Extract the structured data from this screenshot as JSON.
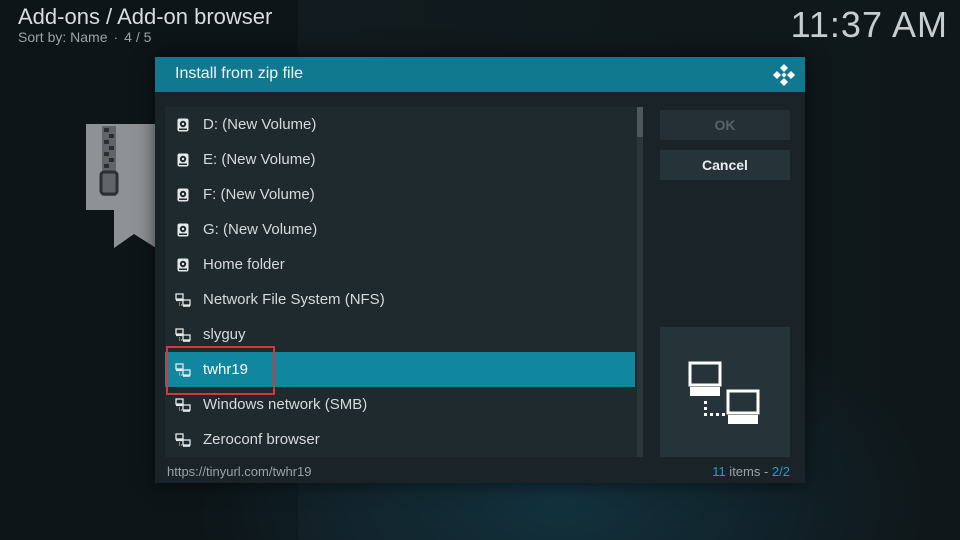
{
  "header": {
    "breadcrumb": "Add-ons / Add-on browser",
    "sort_label": "Sort by: Name",
    "sort_separator": "·",
    "page_position": "4 / 5",
    "clock": "11:37 AM"
  },
  "dialog": {
    "title": "Install from zip file",
    "items": [
      {
        "label": "D: (New Volume)",
        "icon": "hard-drive-icon"
      },
      {
        "label": "E: (New Volume)",
        "icon": "hard-drive-icon"
      },
      {
        "label": "F: (New Volume)",
        "icon": "hard-drive-icon"
      },
      {
        "label": "G: (New Volume)",
        "icon": "hard-drive-icon"
      },
      {
        "label": "Home folder",
        "icon": "hard-drive-icon"
      },
      {
        "label": "Network File System (NFS)",
        "icon": "network-icon"
      },
      {
        "label": "slyguy",
        "icon": "network-icon"
      },
      {
        "label": "twhr19",
        "icon": "network-icon",
        "selected": true
      },
      {
        "label": "Windows network (SMB)",
        "icon": "network-icon"
      },
      {
        "label": "Zeroconf browser",
        "icon": "network-icon"
      }
    ],
    "ok_label": "OK",
    "cancel_label": "Cancel",
    "status_path": "https://tinyurl.com/twhr19",
    "items_count": "11",
    "items_word": " items - ",
    "page": "2/2"
  },
  "colors": {
    "accent": "#11879f",
    "header_bar": "#11798f",
    "highlight_box": "#d23a3a"
  }
}
